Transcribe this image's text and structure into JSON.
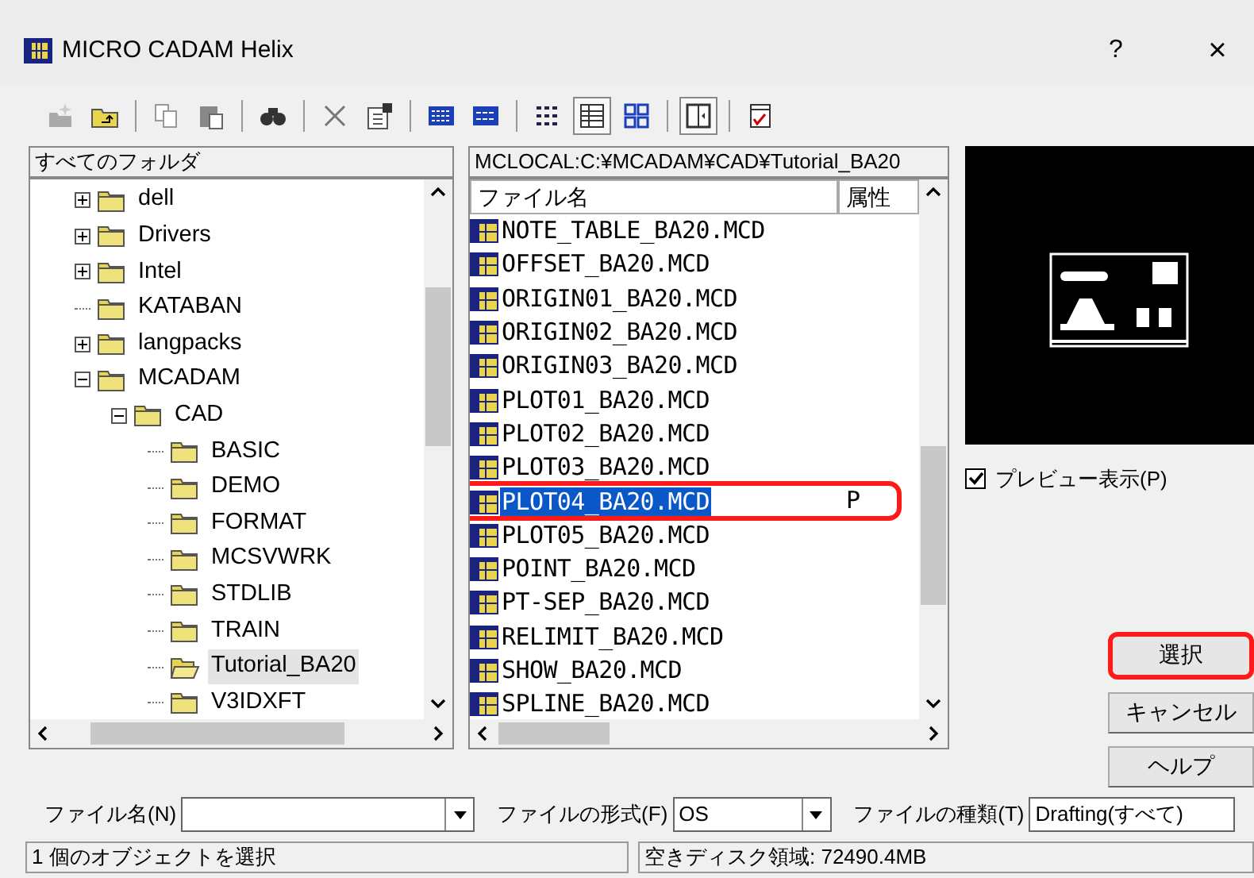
{
  "window": {
    "title": "MICRO CADAM Helix",
    "buttons": [
      "?",
      "×"
    ]
  },
  "toolbar": [
    {
      "kind": "new-folder",
      "pressed": false
    },
    {
      "kind": "up-folder",
      "pressed": false
    },
    {
      "kind": "sep"
    },
    {
      "kind": "copy",
      "pressed": false
    },
    {
      "kind": "paste",
      "pressed": false
    },
    {
      "kind": "sep"
    },
    {
      "kind": "find",
      "pressed": false
    },
    {
      "kind": "sep"
    },
    {
      "kind": "delete",
      "pressed": false
    },
    {
      "kind": "properties",
      "pressed": false
    },
    {
      "kind": "sep"
    },
    {
      "kind": "large-icons",
      "pressed": false
    },
    {
      "kind": "small-icons",
      "pressed": false
    },
    {
      "kind": "sep"
    },
    {
      "kind": "list",
      "pressed": false
    },
    {
      "kind": "details",
      "pressed": true
    },
    {
      "kind": "thumbnails",
      "pressed": false
    },
    {
      "kind": "sep"
    },
    {
      "kind": "preview-pane",
      "pressed": true
    },
    {
      "kind": "sep"
    },
    {
      "kind": "check",
      "pressed": false
    }
  ],
  "folder_tree": {
    "header": "すべてのフォルダ",
    "items": [
      {
        "label": "dell",
        "expanded": false,
        "selected": false
      },
      {
        "label": "Drivers",
        "expanded": false,
        "selected": false
      },
      {
        "label": "Intel",
        "expanded": false,
        "selected": false
      },
      {
        "label": "KATABAN",
        "selected": false
      },
      {
        "label": "langpacks",
        "expanded": false,
        "selected": false
      },
      {
        "label": "MCADAM",
        "expanded": true,
        "selected": false,
        "children": [
          {
            "label": "CAD",
            "expanded": true,
            "selected": false,
            "children": [
              {
                "label": "BASIC",
                "selected": false
              },
              {
                "label": "DEMO",
                "selected": false
              },
              {
                "label": "FORMAT",
                "selected": false
              },
              {
                "label": "MCSVWRK",
                "selected": false
              },
              {
                "label": "STDLIB",
                "selected": false
              },
              {
                "label": "TRAIN",
                "selected": false
              },
              {
                "label": "Tutorial_BA20",
                "selected": true
              },
              {
                "label": "V3IDXFT",
                "selected": false
              }
            ]
          }
        ]
      }
    ]
  },
  "file_list": {
    "path": "MCLOCAL:C:¥MCADAM¥CAD¥Tutorial_BA20",
    "columns": [
      "ファイル名",
      "属性"
    ],
    "rows": [
      {
        "name": "NOTE_TABLE_BA20.MCD",
        "selected": false,
        "highlighted": false
      },
      {
        "name": "OFFSET_BA20.MCD",
        "selected": false,
        "highlighted": false
      },
      {
        "name": "ORIGIN01_BA20.MCD",
        "selected": false,
        "highlighted": false
      },
      {
        "name": "ORIGIN02_BA20.MCD",
        "selected": false,
        "highlighted": false
      },
      {
        "name": "ORIGIN03_BA20.MCD",
        "selected": false,
        "highlighted": false
      },
      {
        "name": "PLOT01_BA20.MCD",
        "selected": false,
        "highlighted": false
      },
      {
        "name": "PLOT02_BA20.MCD",
        "selected": false,
        "highlighted": false
      },
      {
        "name": "PLOT03_BA20.MCD",
        "selected": false,
        "highlighted": false
      },
      {
        "name": "PLOT04_BA20.MCD",
        "attribute": "P",
        "selected": true,
        "highlighted": true
      },
      {
        "name": "PLOT05_BA20.MCD",
        "selected": false,
        "highlighted": false
      },
      {
        "name": "POINT_BA20.MCD",
        "selected": false,
        "highlighted": false
      },
      {
        "name": "PT-SEP_BA20.MCD",
        "selected": false,
        "highlighted": false
      },
      {
        "name": "RELIMIT_BA20.MCD",
        "selected": false,
        "highlighted": false
      },
      {
        "name": "SHOW_BA20.MCD",
        "selected": false,
        "highlighted": false
      },
      {
        "name": "SPLINE_BA20.MCD",
        "selected": false,
        "highlighted": false
      }
    ]
  },
  "preview": {
    "checkbox_label": "プレビュー表示(P)",
    "checked": true
  },
  "buttons": [
    {
      "label": "選択",
      "highlighted": true
    },
    {
      "label": "キャンセル",
      "highlighted": false
    },
    {
      "label": "ヘルプ",
      "highlighted": false
    }
  ],
  "fields": [
    {
      "label": "ファイル名(N)"
    },
    {
      "label": "ファイルの形式(F)",
      "value": "OS"
    },
    {
      "label": "ファイルの種類(T)",
      "value": "Drafting(すべて)"
    }
  ],
  "status_bar": [
    "1 個のオブジェクトを選択",
    "空きディスク領域: 72490.4MB"
  ]
}
